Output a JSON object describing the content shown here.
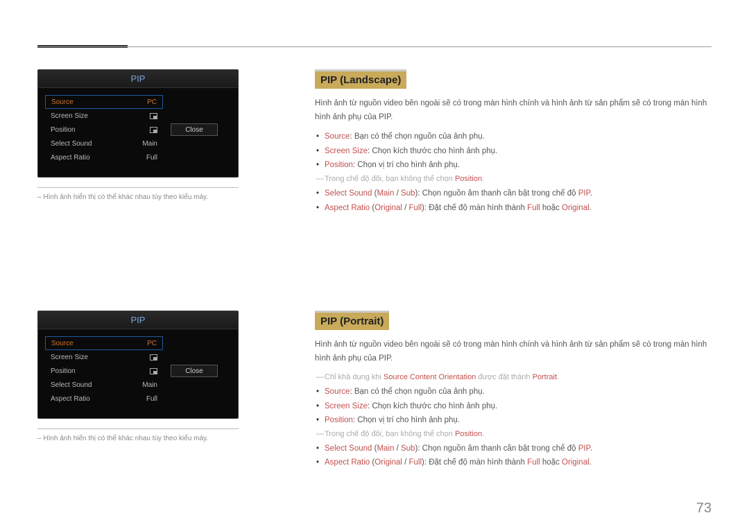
{
  "pageNumber": "73",
  "pip": {
    "title": "PIP",
    "rows": [
      {
        "label": "Source",
        "value": "PC"
      },
      {
        "label": "Screen Size",
        "value": "icon"
      },
      {
        "label": "Position",
        "value": "icon"
      },
      {
        "label": "Select Sound",
        "value": "Main"
      },
      {
        "label": "Aspect Ratio",
        "value": "Full"
      }
    ],
    "closeLabel": "Close"
  },
  "imageNote": "Hình ảnh hiển thị có thể khác nhau tùy theo kiểu máy.",
  "landscape": {
    "heading": "PIP (Landscape)",
    "intro": "Hình ảnh từ nguồn video bên ngoài sẽ có trong màn hình chính và hình ảnh từ sản phẩm sẽ có trong màn hình hình ảnh phụ của PIP.",
    "bullets": {
      "source": {
        "term": "Source",
        "text": ": Bạn có thể chọn nguồn của ảnh phụ."
      },
      "screen": {
        "term": "Screen Size",
        "text": ": Chọn kích thước cho hình ảnh phụ."
      },
      "position": {
        "term": "Position",
        "text": ": Chọn vị trí cho hình ảnh phụ."
      },
      "noteDouble": {
        "pre": "Trong chế độ đôi, bạn không thể chọn ",
        "term": "Position",
        "post": "."
      },
      "selectSound": {
        "term": "Select Sound",
        "opt1": "Main",
        "opt2": "Sub",
        "text": ": Chọn nguồn âm thanh cần bật trong chế độ ",
        "termEnd": "PIP",
        "post": "."
      },
      "aspect": {
        "term": "Aspect Ratio",
        "opt1": "Original",
        "opt2": "Full",
        "text": ": Đặt chế độ màn hình thành ",
        "v1": "Full",
        "mid": " hoặc ",
        "v2": "Original",
        "post": "."
      }
    }
  },
  "portrait": {
    "heading": "PIP (Portrait)",
    "intro": "Hình ảnh từ nguồn video bên ngoài sẽ có trong màn hình chính và hình ảnh từ sản phẩm sẽ có trong màn hình hình ảnh phụ của PIP.",
    "availNote": {
      "pre": "Chỉ khả dụng khi ",
      "term": "Source Content Orientation",
      "mid": " được đặt thành ",
      "val": "Portrait",
      "post": "."
    },
    "bullets": {
      "source": {
        "term": "Source",
        "text": ": Bạn có thể chọn nguồn của ảnh phụ."
      },
      "screen": {
        "term": "Screen Size",
        "text": ": Chọn kích thước cho hình ảnh phụ."
      },
      "position": {
        "term": "Position",
        "text": ": Chọn vị trí cho hình ảnh phụ."
      },
      "noteDouble": {
        "pre": "Trong chế độ đôi, bạn không thể chọn ",
        "term": "Position",
        "post": "."
      },
      "selectSound": {
        "term": "Select Sound",
        "opt1": "Main",
        "opt2": "Sub",
        "text": ": Chọn nguồn âm thanh cần bật trong chế độ ",
        "termEnd": "PIP",
        "post": "."
      },
      "aspect": {
        "term": "Aspect Ratio",
        "opt1": "Original",
        "opt2": "Full",
        "text": ": Đặt chế độ màn hình thành ",
        "v1": "Full",
        "mid": " hoặc ",
        "v2": "Original",
        "post": "."
      }
    }
  }
}
